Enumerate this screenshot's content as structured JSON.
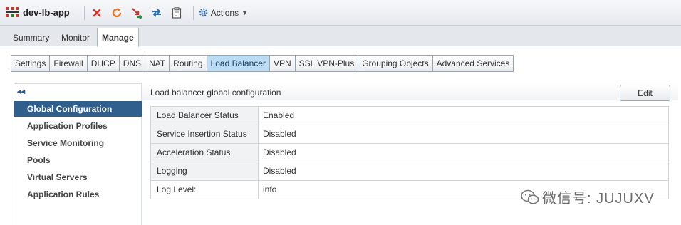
{
  "header": {
    "app_title": "dev-lb-app",
    "actions_label": "Actions"
  },
  "toolbar_icons": [
    "app-icon",
    "delete-icon",
    "refresh-icon",
    "migrate-icon",
    "sync-icon",
    "clipboard-icon",
    "gear-icon"
  ],
  "top_tabs": [
    {
      "label": "Summary"
    },
    {
      "label": "Monitor"
    },
    {
      "label": "Manage",
      "active": true
    }
  ],
  "sub_tabs": [
    {
      "label": "Settings"
    },
    {
      "label": "Firewall"
    },
    {
      "label": "DHCP"
    },
    {
      "label": "DNS"
    },
    {
      "label": "NAT"
    },
    {
      "label": "Routing"
    },
    {
      "label": "Load Balancer",
      "active": true
    },
    {
      "label": "VPN"
    },
    {
      "label": "SSL VPN-Plus"
    },
    {
      "label": "Grouping Objects"
    },
    {
      "label": "Advanced Services"
    }
  ],
  "sidebar": {
    "collapse_glyph": "◂◂",
    "items": [
      {
        "label": "Global Configuration",
        "active": true
      },
      {
        "label": "Application Profiles"
      },
      {
        "label": "Service Monitoring"
      },
      {
        "label": "Pools"
      },
      {
        "label": "Virtual Servers"
      },
      {
        "label": "Application Rules"
      }
    ]
  },
  "main": {
    "title": "Load balancer global configuration",
    "edit_label": "Edit",
    "rows": [
      {
        "key": "Load Balancer Status",
        "value": "Enabled"
      },
      {
        "key": "Service Insertion Status",
        "value": "Disabled"
      },
      {
        "key": "Acceleration Status",
        "value": "Disabled"
      },
      {
        "key": "Logging",
        "value": "Disabled"
      },
      {
        "key": "Log Level:",
        "value": "info"
      }
    ]
  },
  "watermark": {
    "text": "微信号: JUJUXV"
  },
  "colors": {
    "accent_active_nav": "#315f8d",
    "active_subtab": "#bcdcf3",
    "delete_red": "#d9342b",
    "refresh_orange": "#e8731c",
    "icon_blue": "#2f6fb5"
  }
}
